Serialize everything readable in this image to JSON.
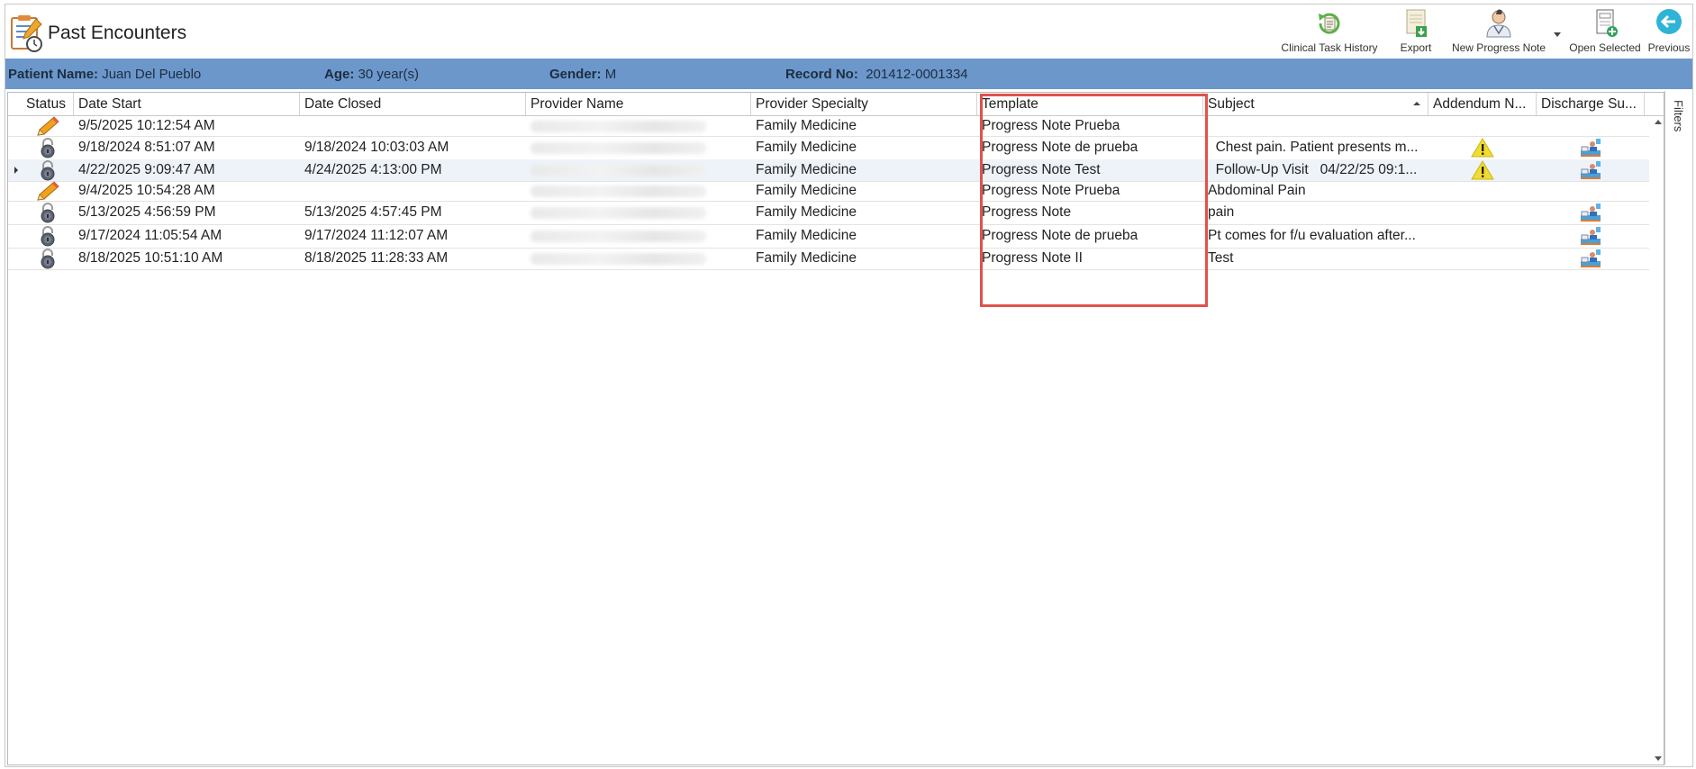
{
  "window": {
    "title": "Past Encounters"
  },
  "toolbar": {
    "clinical_task_history": "Clinical Task History",
    "export": "Export",
    "new_progress_note": "New Progress Note",
    "open_selected": "Open Selected",
    "previous": "Previous"
  },
  "patient": {
    "name_label": "Patient Name:",
    "name_value": "Juan Del Pueblo",
    "age_label": "Age:",
    "age_value": "30 year(s)",
    "gender_label": "Gender:",
    "gender_value": "M",
    "record_label": "Record No:",
    "record_value": "201412-0001334"
  },
  "grid": {
    "columns": [
      "Status",
      "Date Start",
      "Date Closed",
      "Provider Name",
      "Provider Specialty",
      "Template",
      "Subject",
      "Addendum N...",
      "Discharge Su..."
    ],
    "rows": [
      {
        "status": "pencil-icon",
        "date_start": "9/5/2025 10:12:54 AM",
        "date_closed": "",
        "specialty": "Family Medicine",
        "template": "Progress Note Prueba",
        "subject": "",
        "addendum": false,
        "discharge": false
      },
      {
        "status": "lock-icon",
        "date_start": "9/18/2024 8:51:07 AM",
        "date_closed": "9/18/2024 10:03:03 AM",
        "specialty": "Family Medicine",
        "template": "Progress Note de prueba",
        "subject": "  Chest pain. Patient presents m...",
        "addendum": true,
        "discharge": true
      },
      {
        "status": "lock-icon",
        "date_start": "4/22/2025 9:09:47 AM",
        "date_closed": "4/24/2025 4:13:00 PM",
        "specialty": "Family Medicine",
        "template": "Progress Note Test",
        "subject": "  Follow-Up Visit   04/22/25 09:1...",
        "addendum": true,
        "discharge": true
      },
      {
        "status": "pencil-icon",
        "date_start": "9/4/2025 10:54:28 AM",
        "date_closed": "",
        "specialty": "Family Medicine",
        "template": "Progress Note Prueba",
        "subject": "Abdominal Pain",
        "addendum": false,
        "discharge": false
      },
      {
        "status": "lock-icon",
        "date_start": "5/13/2025 4:56:59 PM",
        "date_closed": "5/13/2025 4:57:45 PM",
        "specialty": "Family Medicine",
        "template": "Progress Note",
        "subject": "pain",
        "addendum": false,
        "discharge": true
      },
      {
        "status": "lock-icon",
        "date_start": "9/17/2024 11:05:54 AM",
        "date_closed": "9/17/2024 11:12:07 AM",
        "specialty": "Family Medicine",
        "template": "Progress Note de prueba",
        "subject": "Pt comes for f/u evaluation after...",
        "addendum": false,
        "discharge": true
      },
      {
        "status": "lock-icon",
        "date_start": "8/18/2025 10:51:10 AM",
        "date_closed": "8/18/2025 11:28:33 AM",
        "specialty": "Family Medicine",
        "template": "Progress Note II",
        "subject": "Test",
        "addendum": false,
        "discharge": true
      }
    ],
    "selected_row": 2,
    "sorted_column": "Subject"
  },
  "filters_label": "Filters",
  "colors": {
    "patient_bar": "#6b97cb",
    "highlight": "#e0524b"
  }
}
